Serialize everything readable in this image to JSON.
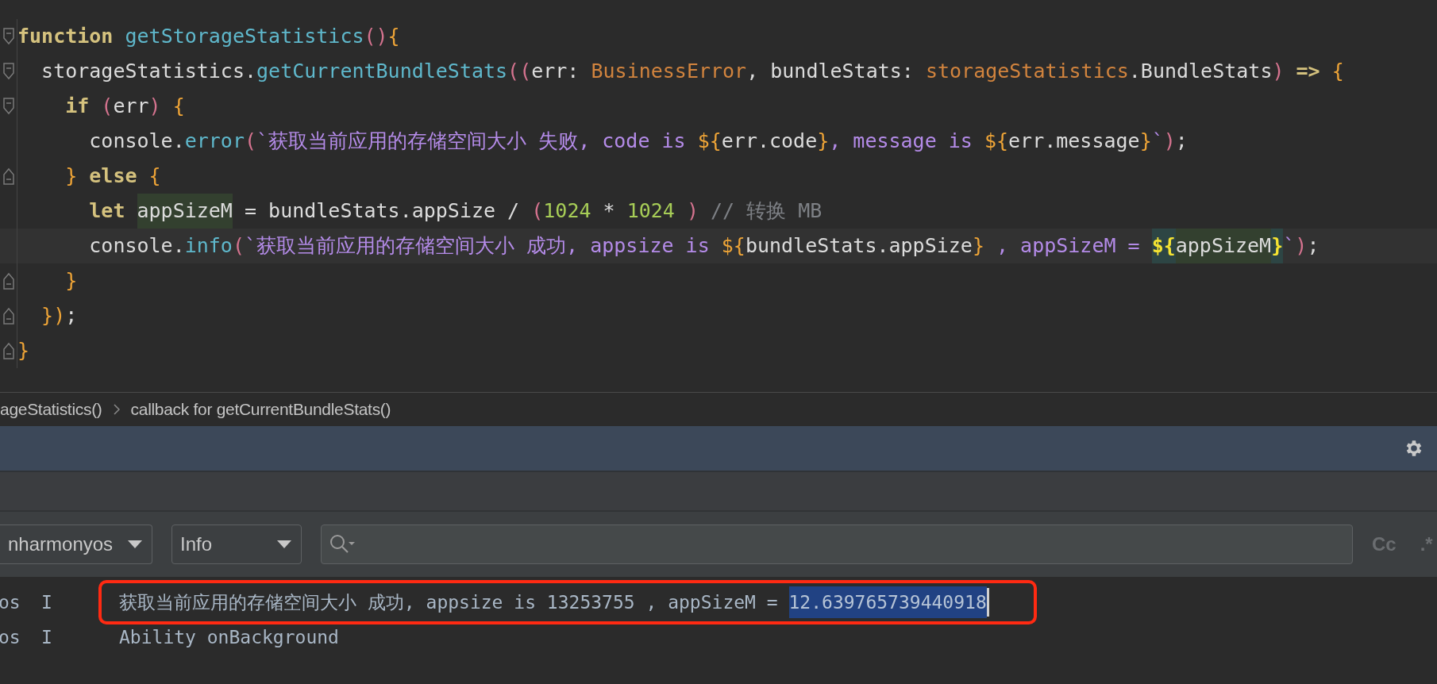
{
  "editor": {
    "lines": [
      {
        "fold_start": true,
        "fold_end": false,
        "current": false,
        "tokens": [
          {
            "kind": "keyword",
            "text": "function"
          },
          {
            "kind": "func",
            "text": " getStorageStatistics"
          },
          {
            "kind": "paren",
            "text": "()"
          },
          {
            "kind": "brace",
            "text": "{"
          }
        ]
      },
      {
        "fold_start": true,
        "fold_end": false,
        "current": false,
        "tokens": [
          {
            "kind": "plain",
            "text": "  storageStatistics."
          },
          {
            "kind": "func",
            "text": "getCurrentBundleStats"
          },
          {
            "kind": "paren",
            "text": "(("
          },
          {
            "kind": "plain",
            "text": "err: "
          },
          {
            "kind": "type",
            "text": "BusinessError"
          },
          {
            "kind": "plain",
            "text": ", bundleStats: "
          },
          {
            "kind": "type",
            "text": "storageStatistics"
          },
          {
            "kind": "plain",
            "text": ".BundleStats"
          },
          {
            "kind": "paren",
            "text": ")"
          },
          {
            "kind": "keyword",
            "text": " =>"
          },
          {
            "kind": "brace",
            "text": " {"
          }
        ]
      },
      {
        "fold_start": true,
        "fold_end": false,
        "current": false,
        "tokens": [
          {
            "kind": "keyword",
            "text": "    if"
          },
          {
            "kind": "paren",
            "text": " ("
          },
          {
            "kind": "plain",
            "text": "err"
          },
          {
            "kind": "paren",
            "text": ")"
          },
          {
            "kind": "brace",
            "text": " {"
          }
        ]
      },
      {
        "fold_start": false,
        "fold_end": false,
        "current": false,
        "tokens": [
          {
            "kind": "plain",
            "text": "      console."
          },
          {
            "kind": "func",
            "text": "error"
          },
          {
            "kind": "paren",
            "text": "("
          },
          {
            "kind": "string",
            "text": "`获取当前应用的存储空间大小 失败, code is "
          },
          {
            "kind": "brace",
            "text": "${"
          },
          {
            "kind": "plain",
            "text": "err.code"
          },
          {
            "kind": "brace",
            "text": "}"
          },
          {
            "kind": "string",
            "text": ", message is "
          },
          {
            "kind": "brace",
            "text": "${"
          },
          {
            "kind": "plain",
            "text": "err.message"
          },
          {
            "kind": "brace",
            "text": "}"
          },
          {
            "kind": "string",
            "text": "`"
          },
          {
            "kind": "paren",
            "text": ")"
          },
          {
            "kind": "plain",
            "text": ";"
          }
        ]
      },
      {
        "fold_start": false,
        "fold_end": true,
        "current": false,
        "tokens": [
          {
            "kind": "brace",
            "text": "    }"
          },
          {
            "kind": "keyword",
            "text": " else"
          },
          {
            "kind": "brace",
            "text": " {"
          }
        ]
      },
      {
        "fold_start": false,
        "fold_end": false,
        "current": false,
        "tokens": [
          {
            "kind": "keyword",
            "text": "      let "
          },
          {
            "kind": "usage",
            "text": "appSizeM"
          },
          {
            "kind": "plain",
            "text": " = bundleStats.appSize / "
          },
          {
            "kind": "paren",
            "text": "("
          },
          {
            "kind": "number",
            "text": "1024"
          },
          {
            "kind": "plain",
            "text": " * "
          },
          {
            "kind": "number",
            "text": "1024"
          },
          {
            "kind": "paren",
            "text": " )"
          },
          {
            "kind": "comment",
            "text": " // 转换 MB"
          }
        ]
      },
      {
        "fold_start": false,
        "fold_end": false,
        "current": true,
        "tokens": [
          {
            "kind": "plain",
            "text": "      console."
          },
          {
            "kind": "func",
            "text": "info"
          },
          {
            "kind": "paren",
            "text": "("
          },
          {
            "kind": "string",
            "text": "`获取当前应用的存储空间大小 成功, appsize is "
          },
          {
            "kind": "brace",
            "text": "${"
          },
          {
            "kind": "plain",
            "text": "bundleStats.appSize"
          },
          {
            "kind": "brace",
            "text": "}"
          },
          {
            "kind": "string",
            "text": " , appSizeM = "
          },
          {
            "kind": "match",
            "text": "${"
          },
          {
            "kind": "usage",
            "text": "appSizeM"
          },
          {
            "kind": "match",
            "text": "}"
          },
          {
            "kind": "string",
            "text": "`"
          },
          {
            "kind": "paren",
            "text": ")"
          },
          {
            "kind": "plain",
            "text": ";"
          }
        ]
      },
      {
        "fold_start": false,
        "fold_end": true,
        "current": false,
        "tokens": [
          {
            "kind": "brace",
            "text": "    }"
          }
        ]
      },
      {
        "fold_start": false,
        "fold_end": true,
        "current": false,
        "tokens": [
          {
            "kind": "brace",
            "text": "  })"
          },
          {
            "kind": "plain",
            "text": ";"
          }
        ]
      },
      {
        "fold_start": false,
        "fold_end": true,
        "current": false,
        "tokens": [
          {
            "kind": "brace",
            "text": "}"
          }
        ]
      }
    ]
  },
  "breadcrumbs": [
    "ageStatistics()",
    "callback for getCurrentBundleStats()"
  ],
  "log_panel": {
    "process_filter": "nharmonyos",
    "level_filter": "Info",
    "case_toggle": "Cc",
    "regex_toggle": ".*",
    "rows": [
      {
        "tag": "os",
        "level": "I",
        "message": "获取当前应用的存储空间大小 成功, appsize is 13253755 , appSizeM = ",
        "selection": "12.639765739440918",
        "annotated": true
      },
      {
        "tag": "os",
        "level": "I",
        "message": "Ability onBackground",
        "annotated": false
      }
    ]
  }
}
